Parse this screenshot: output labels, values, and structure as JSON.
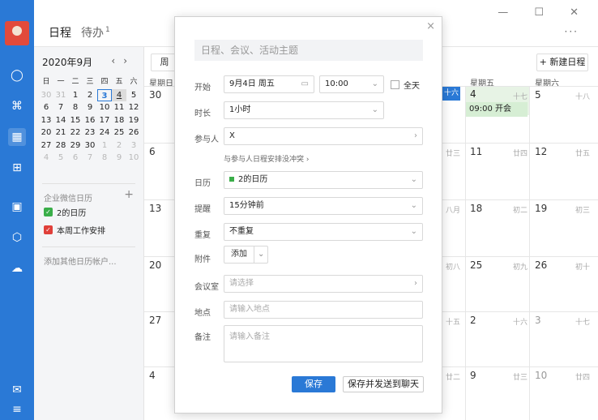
{
  "colors": {
    "accent": "#2a79d6",
    "green": "#3aae49",
    "red": "#e0403a",
    "event_bg": "#d6eed4"
  },
  "header": {
    "tab_schedule": "日程",
    "tab_todo": "待办",
    "todo_count": "1",
    "win_controls": "— ☐ ✕",
    "more": "···"
  },
  "rail": {
    "icons": [
      "avatar",
      "chat-icon",
      "org-icon",
      "calendar-icon",
      "apps-icon",
      "doc-icon",
      "workbench-icon",
      "cloud-icon",
      "mail-icon",
      "menu-icon"
    ]
  },
  "sidebar": {
    "month_title": "2020年9月",
    "prev": "‹",
    "next": "›",
    "weekdays": [
      "日",
      "一",
      "二",
      "三",
      "四",
      "五",
      "六"
    ],
    "weeks": [
      [
        "30",
        "31",
        "1",
        "2",
        "3",
        "4",
        "5"
      ],
      [
        "6",
        "7",
        "8",
        "9",
        "10",
        "11",
        "12"
      ],
      [
        "13",
        "14",
        "15",
        "16",
        "17",
        "18",
        "19"
      ],
      [
        "20",
        "21",
        "22",
        "23",
        "24",
        "25",
        "26"
      ],
      [
        "27",
        "28",
        "29",
        "30",
        "1",
        "2",
        "3"
      ],
      [
        "4",
        "5",
        "6",
        "7",
        "8",
        "9",
        "10"
      ]
    ],
    "group_title": "企业微信日历",
    "group_plus": "+",
    "calendars": [
      {
        "label": "2的日历",
        "color": "#3aae49"
      },
      {
        "label": "本周工作安排",
        "color": "#e0403a"
      }
    ],
    "add_account": "添加其他日历帐户..."
  },
  "grid": {
    "week_button": "周",
    "new_button": "+ 新建日程",
    "col_heads": [
      "星期日",
      "星期五",
      "星期六"
    ],
    "rows": [
      {
        "sun": "30",
        "lunar_thu": "十六",
        "fri": "4",
        "fri_lunar": "十七",
        "sat": "5",
        "sat_lunar": "十八"
      },
      {
        "sun": "6",
        "lunar_thu": "廿三",
        "fri": "11",
        "fri_lunar": "廿四",
        "sat": "12",
        "sat_lunar": "廿五"
      },
      {
        "sun": "13",
        "lunar_thu": "八月",
        "fri": "18",
        "fri_lunar": "初二",
        "sat": "19",
        "sat_lunar": "初三"
      },
      {
        "sun": "20",
        "lunar_thu": "初八",
        "fri": "25",
        "fri_lunar": "初九",
        "sat": "26",
        "sat_lunar": "初十"
      },
      {
        "sun": "27",
        "lunar_thu": "十五",
        "fri": "2",
        "fri_lunar": "十六",
        "sat": "3",
        "sat_lunar": "十七"
      },
      {
        "sun": "4",
        "lunar_thu": "廿二",
        "fri": "9",
        "fri_lunar": "廿三",
        "sat": "10",
        "sat_lunar": "廿四"
      }
    ],
    "event": "09:00 开会"
  },
  "modal": {
    "close": "×",
    "title_placeholder": "日程、会议、活动主题",
    "start_label": "开始",
    "start_date": "9月4日 周五",
    "start_time": "10:00",
    "allday_label": "全天",
    "duration_label": "时长",
    "duration_value": "1小时",
    "attendees_label": "参与人",
    "attendees_value": "X",
    "conflict_text": "与参与人日程安排没冲突 ›",
    "calendar_label": "日历",
    "calendar_value": "2的日历",
    "reminder_label": "提醒",
    "reminder_value": "15分钟前",
    "repeat_label": "重复",
    "repeat_value": "不重复",
    "attach_label": "附件",
    "attach_button": "添加",
    "room_label": "会议室",
    "room_placeholder": "请选择",
    "location_label": "地点",
    "location_placeholder": "请输入地点",
    "note_label": "备注",
    "note_placeholder": "请输入备注",
    "save": "保存",
    "save_send": "保存并发送到聊天"
  }
}
